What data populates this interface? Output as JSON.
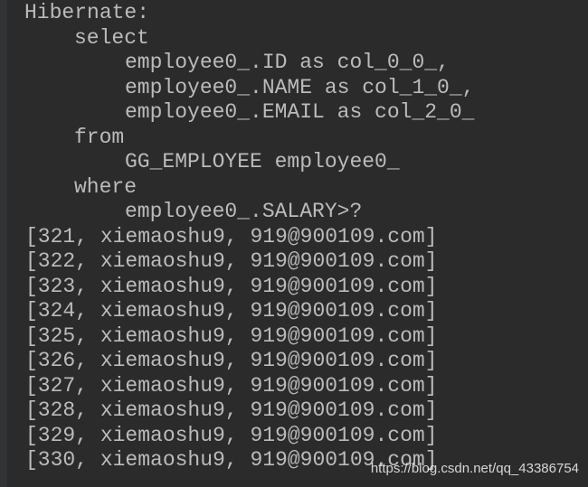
{
  "console": {
    "sql_lines": [
      {
        "indent": 0,
        "text": "Hibernate:"
      },
      {
        "indent": 1,
        "text": "select"
      },
      {
        "indent": 2,
        "text": "employee0_.ID as col_0_0_,"
      },
      {
        "indent": 2,
        "text": "employee0_.NAME as col_1_0_,"
      },
      {
        "indent": 2,
        "text": "employee0_.EMAIL as col_2_0_"
      },
      {
        "indent": 1,
        "text": "from"
      },
      {
        "indent": 2,
        "text": "GG_EMPLOYEE employee0_"
      },
      {
        "indent": 1,
        "text": "where"
      },
      {
        "indent": 2,
        "text": "employee0_.SALARY>?"
      }
    ],
    "rows": [
      "[321, xiemaoshu9, 919@900109.com]",
      "[322, xiemaoshu9, 919@900109.com]",
      "[323, xiemaoshu9, 919@900109.com]",
      "[324, xiemaoshu9, 919@900109.com]",
      "[325, xiemaoshu9, 919@900109.com]",
      "[326, xiemaoshu9, 919@900109.com]",
      "[327, xiemaoshu9, 919@900109.com]",
      "[328, xiemaoshu9, 919@900109.com]",
      "[329, xiemaoshu9, 919@900109.com]",
      "[330, xiemaoshu9, 919@900109.com]"
    ]
  },
  "watermark": "https://blog.csdn.net/qq_43386754",
  "colors": {
    "background": "#2b2b2b",
    "text": "#bbbbbb"
  }
}
